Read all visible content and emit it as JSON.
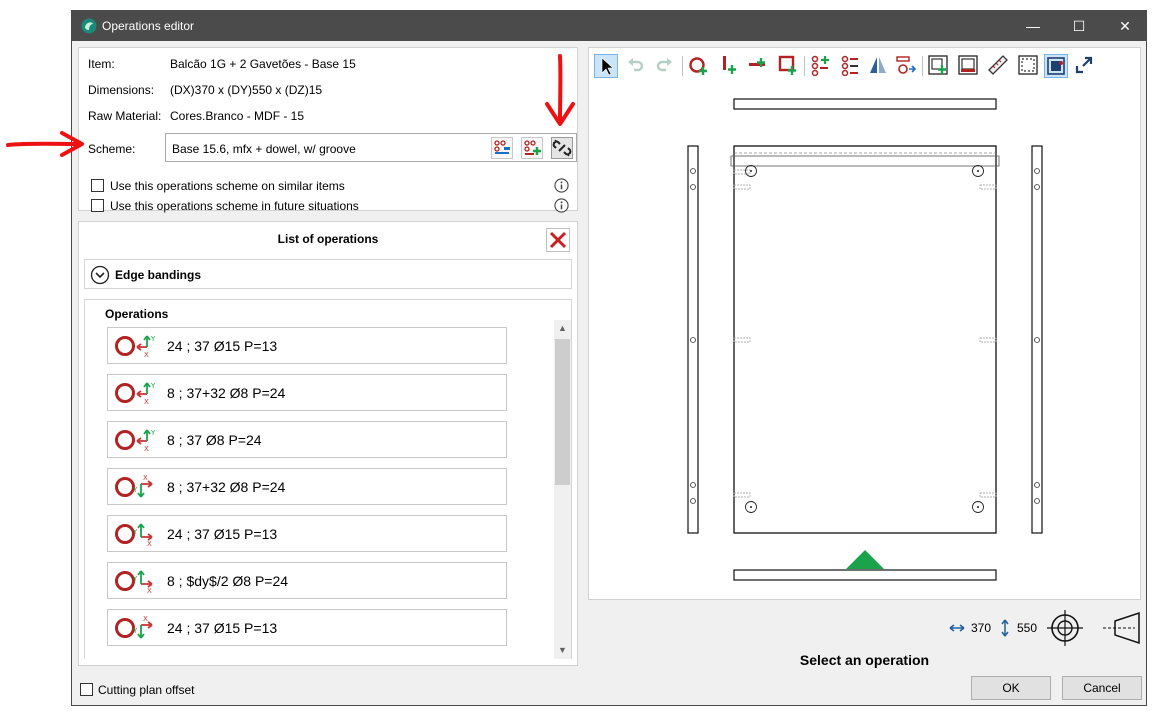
{
  "window": {
    "title": "Operations editor",
    "controls": {
      "minimize": "—",
      "maximize": "☐",
      "close": "✕"
    }
  },
  "details": {
    "item_label": "Item:",
    "item_value": "Balcão 1G + 2 Gavetões - Base 15",
    "dimensions_label": "Dimensions:",
    "dimensions_value": "(DX)370 x (DY)550 x (DZ)15",
    "raw_material_label": "Raw Material:",
    "raw_material_value": "Cores.Branco - MDF - 15",
    "scheme_label": "Scheme:",
    "scheme_value": "Base 15.6, mfx + dowel, w/ groove"
  },
  "checkboxes": [
    {
      "label": "Use this operations scheme on similar items",
      "checked": false
    },
    {
      "label": "Use this operations scheme in future situations",
      "checked": false
    }
  ],
  "list": {
    "title": "List of operations",
    "edge_bandings_label": "Edge bandings",
    "operations_label": "Operations",
    "items": [
      {
        "text": "24 ; 37 Ø15 P=13",
        "icon": "hole-arrow-up-left-icon"
      },
      {
        "text": "8 ; 37+32 Ø8 P=24",
        "icon": "hole-arrow-up-left-icon"
      },
      {
        "text": "8 ; 37 Ø8 P=24",
        "icon": "hole-arrow-up-left-icon"
      },
      {
        "text": "8 ; 37+32 Ø8 P=24",
        "icon": "hole-arrow-down-right-icon"
      },
      {
        "text": "24 ; 37 Ø15 P=13",
        "icon": "hole-arrow-up-right-icon"
      },
      {
        "text": "8 ; $dy$/2 Ø8 P=24",
        "icon": "hole-arrow-up-right-icon"
      },
      {
        "text": "24 ; 37 Ø15 P=13",
        "icon": "hole-arrow-down-right-icon"
      }
    ]
  },
  "footer": {
    "cutting_plan_offset_label": "Cutting plan offset",
    "ok_label": "OK",
    "cancel_label": "Cancel"
  },
  "preview": {
    "status": "Select an operation",
    "width_value": "370",
    "height_value": "550"
  },
  "colors": {
    "titlebar": "#4b4b4b",
    "accent_red": "#b22222",
    "accent_green": "#1aa34a",
    "annotation_red": "#ee1111"
  }
}
